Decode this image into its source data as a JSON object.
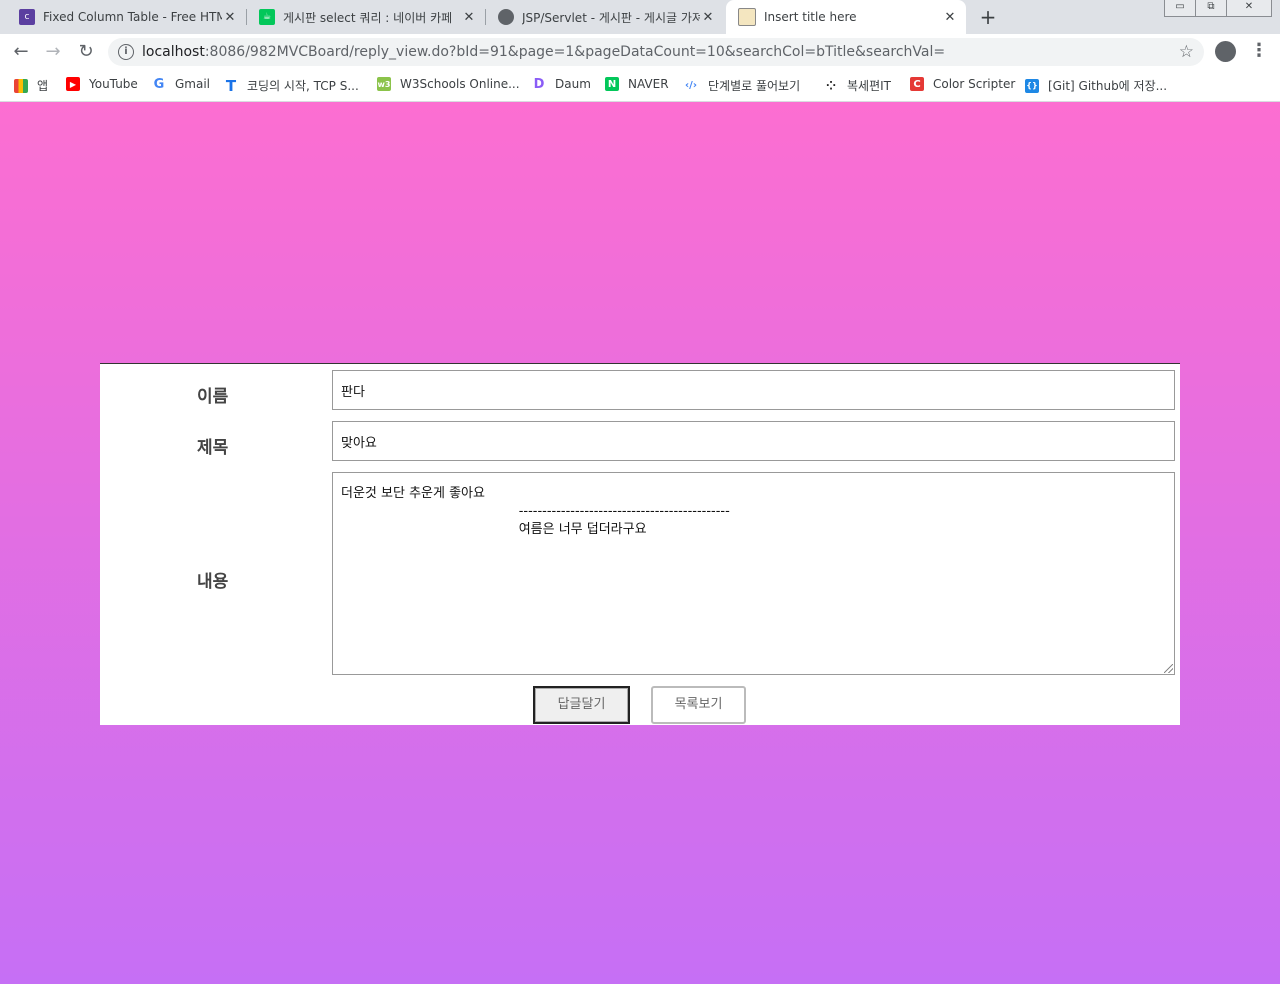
{
  "browser": {
    "tabs": [
      {
        "title": "Fixed Column Table - Free HTML",
        "icon": "colorlib-icon",
        "active": false
      },
      {
        "title": "게시판 select 쿼리 : 네이버 카페",
        "icon": "naver-cafe-icon",
        "active": false
      },
      {
        "title": "JSP/Servlet - 게시판 - 게시글 가져오기",
        "icon": "globe-icon",
        "active": false
      },
      {
        "title": "Insert title here",
        "icon": "page-icon",
        "active": true
      }
    ],
    "new_tab": "+",
    "window_controls": {
      "minimize": "▭",
      "restore": "⧉",
      "close": "✕"
    },
    "url_host": "localhost",
    "url_rest": ":8086/982MVCBoard/reply_view.do?bId=91&page=1&pageDataCount=10&searchCol=bTitle&searchVal=",
    "bookmarks": [
      {
        "label": "앱",
        "icon": "apps-grid-icon"
      },
      {
        "label": "YouTube",
        "icon": "youtube-icon"
      },
      {
        "label": "Gmail",
        "icon": "google-icon"
      },
      {
        "label": "코딩의 시작, TCP S...",
        "icon": "tcp-school-icon"
      },
      {
        "label": "W3Schools Online...",
        "icon": "w3schools-icon"
      },
      {
        "label": "Daum",
        "icon": "daum-icon"
      },
      {
        "label": "NAVER",
        "icon": "naver-icon"
      },
      {
        "label": "단계별로 풀어보기",
        "icon": "code-icon"
      },
      {
        "label": "복세편IT",
        "icon": "dots-icon"
      },
      {
        "label": "Color Scripter",
        "icon": "color-scripter-icon"
      },
      {
        "label": "[Git] Github에 저장...",
        "icon": "brackets-icon"
      }
    ]
  },
  "form": {
    "name_label": "이름",
    "name_value": "판다",
    "title_label": "제목",
    "title_value": "맞아요",
    "content_label": "내용",
    "content_value": "더운것 보단 추운게 좋아요\n                                           ---------------------------------------------\n                                           여름은 너무 덥더라구요",
    "reply_button": "답글달기",
    "list_button": "목록보기"
  },
  "colors": {
    "gradient_top": "#fc6ed1",
    "gradient_bottom": "#c66ff5"
  }
}
